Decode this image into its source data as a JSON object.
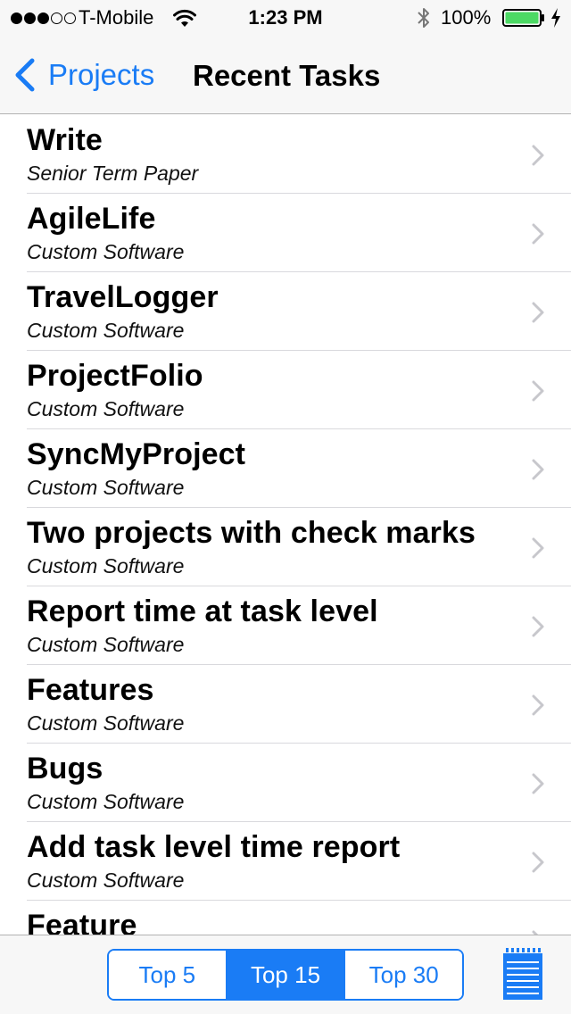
{
  "status_bar": {
    "carrier": "T-Mobile",
    "time": "1:23 PM",
    "battery_percent": "100%",
    "signal_bars_filled": 3,
    "signal_bars_total": 5
  },
  "nav": {
    "back_label": "Projects",
    "title": "Recent Tasks"
  },
  "tasks": [
    {
      "title": "Write",
      "subtitle": "Senior Term Paper"
    },
    {
      "title": "AgileLife",
      "subtitle": "Custom Software"
    },
    {
      "title": "TravelLogger",
      "subtitle": "Custom Software"
    },
    {
      "title": "ProjectFolio",
      "subtitle": "Custom Software"
    },
    {
      "title": "SyncMyProject",
      "subtitle": "Custom Software"
    },
    {
      "title": "Two projects with check marks",
      "subtitle": "Custom Software"
    },
    {
      "title": "Report time at task level",
      "subtitle": "Custom Software"
    },
    {
      "title": "Features",
      "subtitle": "Custom Software"
    },
    {
      "title": "Bugs",
      "subtitle": "Custom Software"
    },
    {
      "title": "Add task level time report",
      "subtitle": "Custom Software"
    },
    {
      "title": "Feature",
      "subtitle": ""
    }
  ],
  "toolbar": {
    "segments": [
      "Top 5",
      "Top 15",
      "Top 30"
    ],
    "selected_segment": "Top 15",
    "notes_icon": "notepad-icon"
  },
  "colors": {
    "accent": "#1a7cf5",
    "battery": "#4cd964",
    "bar_background": "#f7f7f7",
    "separator": "#d9d9dd"
  },
  "icons": {
    "back": "chevron-left-icon",
    "disclosure": "chevron-right-icon",
    "wifi": "wifi-icon",
    "bluetooth": "bluetooth-icon",
    "battery": "battery-icon",
    "charging": "charging-bolt-icon"
  }
}
